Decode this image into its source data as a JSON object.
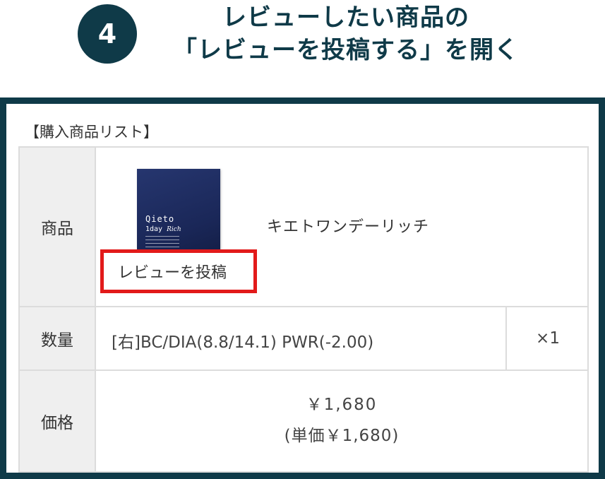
{
  "step": {
    "number": "4",
    "title_line1": "レビューしたい商品の",
    "title_line2": "「レビューを投稿する」を開く"
  },
  "purchase_list": {
    "title": "【購入商品リスト】",
    "product_header": "商品",
    "quantity_header": "数量",
    "price_header": "価格",
    "product": {
      "package_brand": "Qieto",
      "package_sub": "1day",
      "package_sub_italic": "Rich",
      "name": "キエトワンデーリッチ",
      "review_button": "レビューを投稿"
    },
    "variant": "[右]BC/DIA(8.8/14.1) PWR(-2.00)",
    "quantity": "×1",
    "price": "￥1,680",
    "unit_price": "(単価￥1,680)"
  },
  "colors": {
    "accent_dark_teal": "#0f3a48",
    "highlight_red": "#e21a1a",
    "header_cell_bg": "#efefef"
  }
}
